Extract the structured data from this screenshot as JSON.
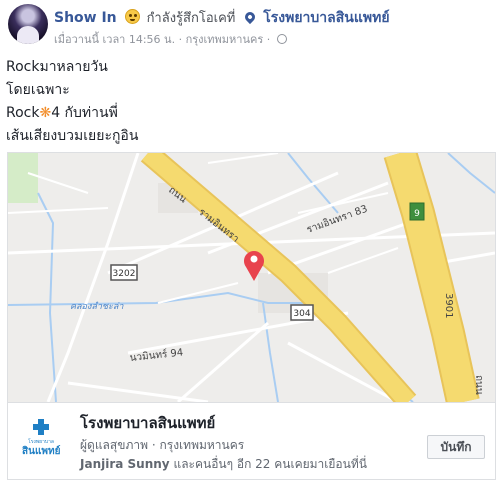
{
  "post": {
    "author": "Show In",
    "feeling": "กำลังรู้สึกโอเคที่",
    "feeling_icon": "smiling-face-icon",
    "place": "โรงพยาบาลสินแพทย์",
    "timestamp": "เมื่อวานนี้ เวลา 14:56 น.",
    "separator": "·",
    "location": "กรุงเทพมหานคร",
    "privacy_icon": "globe-icon",
    "lines": [
      "Rockมาหลายวัน",
      "โดยเฉพาะ",
      "4 กับท่านพี่",
      "เส้นเสียงบวมเยยะกูอิน"
    ],
    "rock_word": "Rock",
    "rock_symbol": "❋"
  },
  "map": {
    "labels": {
      "road_thanon": "ถนน",
      "road_ramintra": "รามอินทรา",
      "soi_83": "รามอินทรา 83",
      "soi_94": "นวมินทร์ 94",
      "canal": "คลองลำชะล่า",
      "highway_3202": "3202",
      "highway_304": "304",
      "highway_9": "9",
      "highway_3901": "3901",
      "road_right_edge": "ถนน"
    },
    "colors": {
      "background": "#eeedeb",
      "main_road": "#f5da6f",
      "water": "#a9cdf2",
      "minor_road": "#ffffff",
      "pin": "#e8434d"
    }
  },
  "place_card": {
    "logo_top": "โรงพยาบาล",
    "logo_bottom": "สินแพทย์",
    "title": "โรงพยาบาลสินแพทย์",
    "category": "ผู้ดูแลสุขภาพ",
    "city": "กรุงเทพมหานคร",
    "visitor_name": "Janjira Sunny",
    "visitor_rest": "และคนอื่นๆ อีก 22 คนเคยมาเยือนที่นี่",
    "save_label": "บันทึก"
  },
  "colors": {
    "link": "#385898",
    "meta": "#90949c",
    "text": "#1d2129"
  }
}
